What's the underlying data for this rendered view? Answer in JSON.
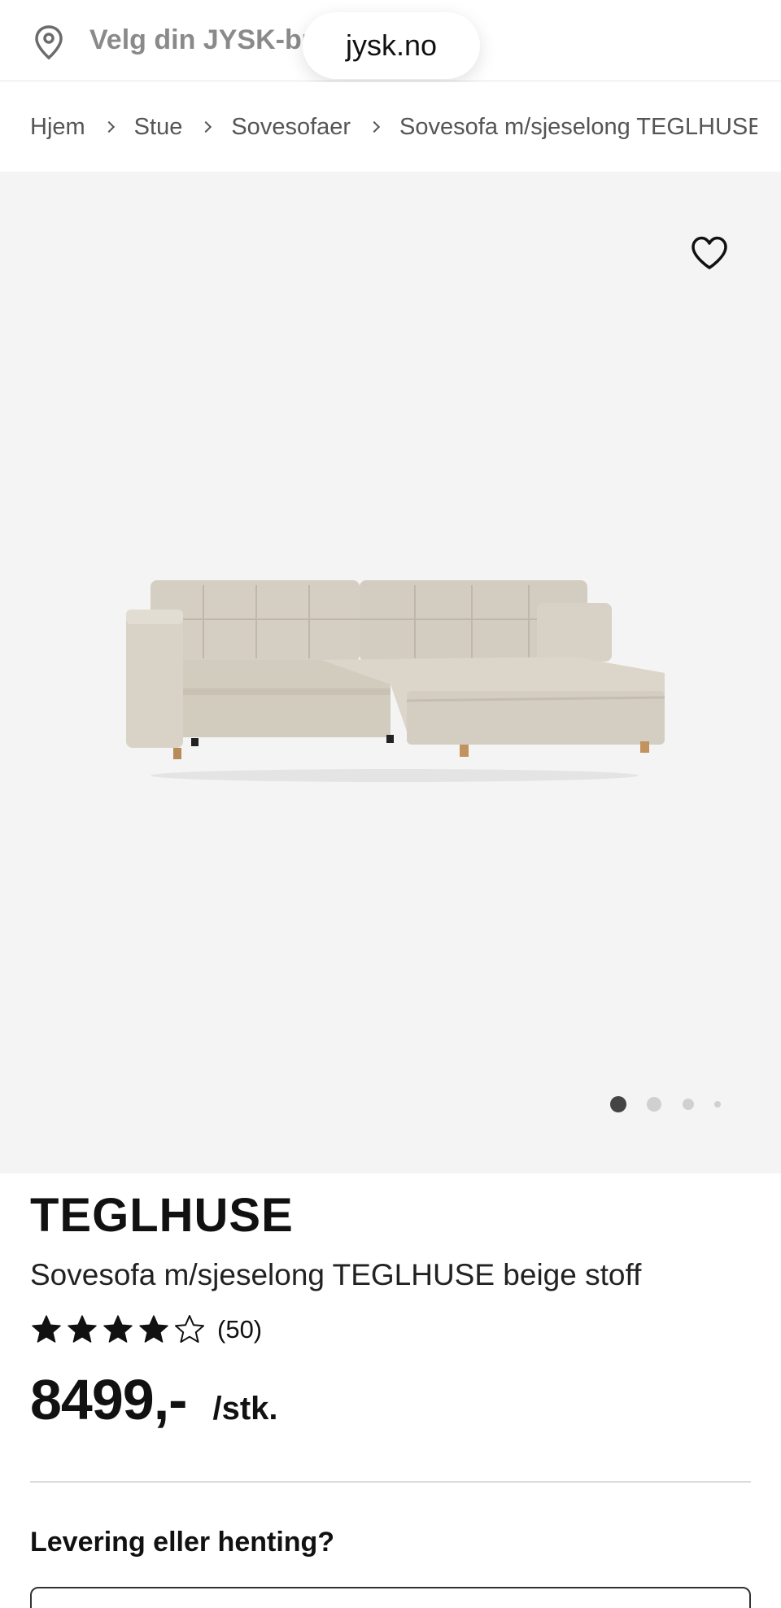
{
  "store_bar": {
    "label": "Velg din JYSK-bu",
    "icon": "location-pin-icon"
  },
  "browser": {
    "url": "jysk.no"
  },
  "breadcrumb": {
    "items": [
      "Hjem",
      "Stue",
      "Sovesofaer",
      "Sovesofa m/sjeselong TEGLHUSE"
    ]
  },
  "gallery": {
    "favorite_icon": "heart-icon",
    "image_name": "sofa-product-image",
    "slide_count": 4,
    "active_slide": 1
  },
  "product": {
    "brand": "TEGLHUSE",
    "name": "Sovesofa m/sjeselong TEGLHUSE beige stoff",
    "rating": 4,
    "rating_max": 5,
    "review_count": "(50)",
    "price": "8499,-",
    "unit": "/stk."
  },
  "delivery": {
    "title": "Levering eller henting?"
  },
  "colors": {
    "gallery_bg": "#f4f4f4",
    "sofa_fabric": "#d9d3c7",
    "text": "#111111"
  }
}
